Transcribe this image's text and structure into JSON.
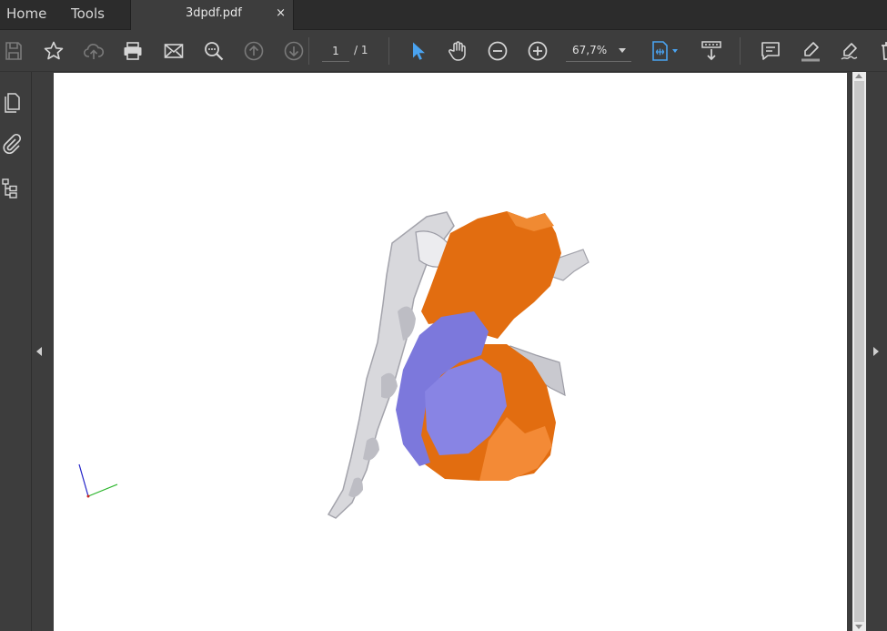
{
  "tabs": {
    "home_label": "Home",
    "tools_label": "Tools",
    "document_title": "3dpdf.pdf",
    "close_glyph": "×"
  },
  "toolbar": {
    "icons": [
      "save-icon",
      "bookmark-star-icon",
      "cloud-upload-icon",
      "print-icon",
      "email-icon",
      "find-icon",
      "previous-page-icon",
      "next-page-icon",
      "select-cursor-icon",
      "hand-tool-icon",
      "zoom-out-icon",
      "zoom-in-icon",
      "fit-page-icon",
      "scroll-mode-icon",
      "comment-icon",
      "highlight-icon",
      "sign-icon",
      "delete-icon"
    ],
    "page_current": "1",
    "page_total": "/ 1",
    "zoom_value": "67,7%",
    "accent_color": "#4aa3f0"
  },
  "left_panel": {
    "icons": [
      "page-thumbnails-icon",
      "attachments-icon",
      "model-tree-icon"
    ]
  },
  "document": {
    "model_colors": {
      "bone": "#d8d8dc",
      "aorta": "#e26d10",
      "ventricle": "#7c78dc"
    }
  }
}
